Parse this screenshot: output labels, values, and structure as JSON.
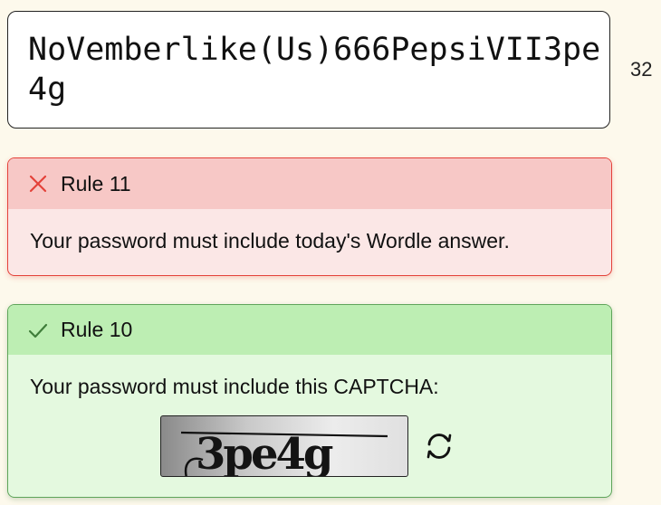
{
  "password": {
    "value": "NoVemberlike(Us)666PepsiVII3pe4g",
    "char_count": "32"
  },
  "rules": [
    {
      "title": "Rule 11",
      "status": "failed",
      "description": "Your password must include today's Wordle answer.",
      "icon": "close-icon"
    },
    {
      "title": "Rule 10",
      "status": "passed",
      "description": "Your password must include this CAPTCHA:",
      "icon": "check-icon",
      "captcha_text": "3pe4g",
      "refresh_icon": "refresh-icon"
    }
  ],
  "colors": {
    "background": "#fdf9ec",
    "fail_border": "#e4423a",
    "fail_header": "#f7c8c6",
    "fail_body": "#fbe7e6",
    "pass_border": "#5fa55a",
    "pass_header": "#bdeeb3",
    "pass_body": "#e4f9df"
  }
}
